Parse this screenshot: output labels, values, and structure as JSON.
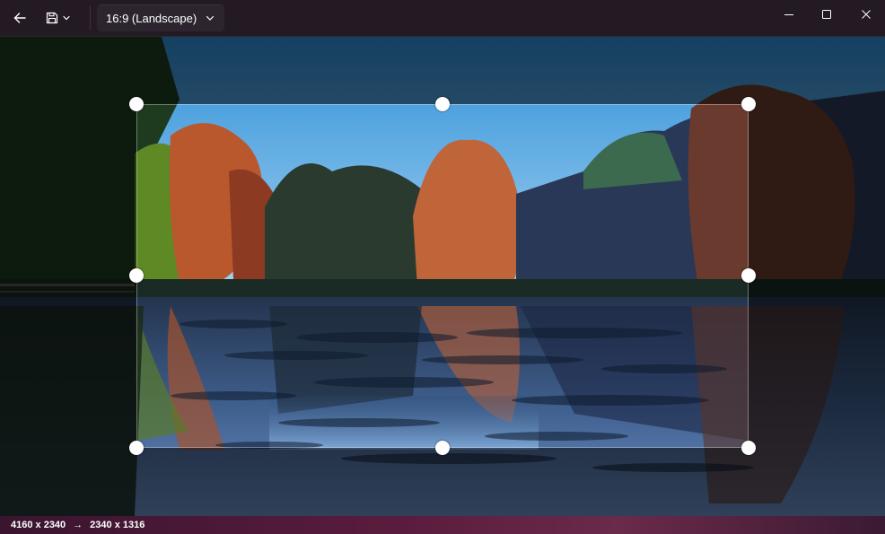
{
  "toolbar": {
    "back_icon": "arrow-left-icon",
    "save_icon": "floppy-disk-icon",
    "save_dropdown_icon": "chevron-down-icon",
    "aspect_ratio": "16:9 (Landscape)"
  },
  "window_controls": [
    "minimize",
    "maximize",
    "close"
  ],
  "status": {
    "original_size": "4160 x 2340",
    "arrow": "→",
    "cropped_size": "2340 x 1316"
  },
  "colors": {
    "titlebar": "#231a24",
    "statusbar_accent": "#5a1c3e",
    "handle": "#ffffff"
  }
}
